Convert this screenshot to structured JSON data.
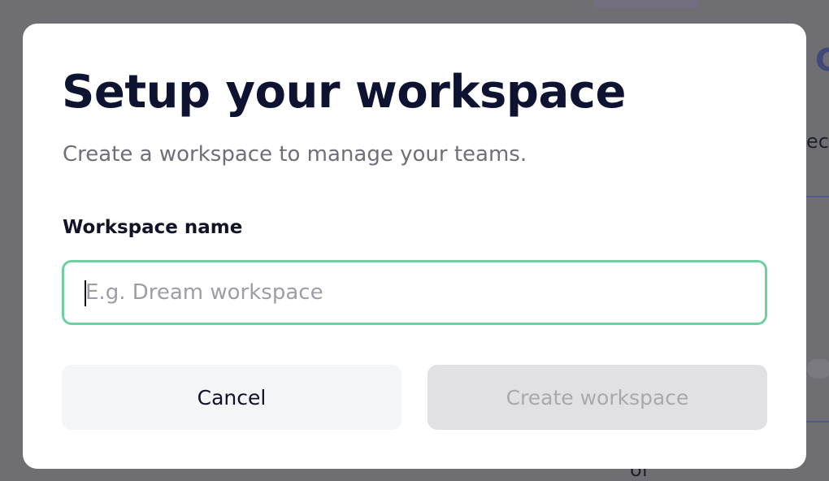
{
  "background_page": {
    "visible_snippet_right": "ec",
    "visible_snippet_bottom": "of"
  },
  "modal": {
    "title": "Setup your workspace",
    "subtitle": "Create a workspace to manage your teams.",
    "workspace_field": {
      "label": "Workspace name",
      "placeholder": "E.g. Dream workspace",
      "value": "",
      "focused": true
    },
    "cancel_label": "Cancel",
    "create_label": "Create workspace",
    "create_disabled": true
  },
  "colors": {
    "overlay": "#6f6f73",
    "title_text": "#0f1332",
    "subtitle_text": "#6e6f7b",
    "focus_border": "#6fcf9f",
    "cancel_bg": "#f4f5f7",
    "disabled_bg": "#e1e1e3",
    "disabled_text": "#a9a9ad"
  }
}
